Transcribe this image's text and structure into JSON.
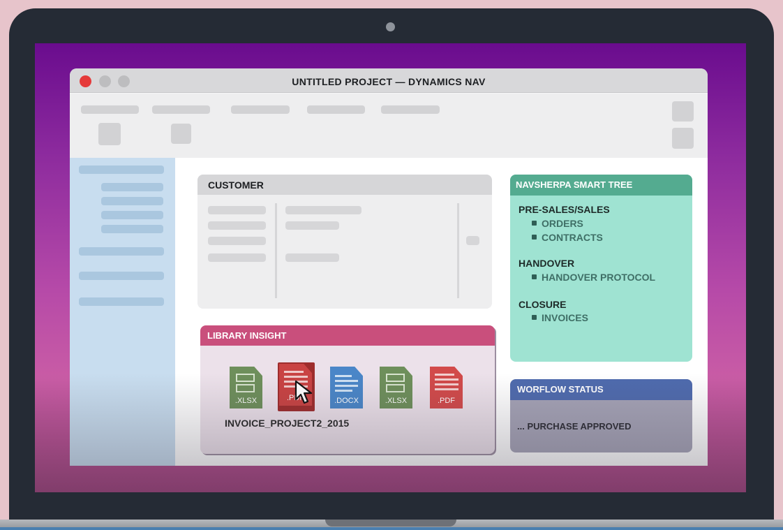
{
  "window": {
    "title": "UNTITLED PROJECT — DYNAMICS NAV",
    "controls": [
      "close",
      "minimize",
      "maximize"
    ],
    "close_color": "#e53a3a"
  },
  "customer": {
    "title": "CUSTOMER"
  },
  "library_insight": {
    "title": "LIBRARY INSIGHT",
    "files": [
      {
        "ext": ".XLSX",
        "color": "#6e8f5b"
      },
      {
        "ext": ".PDF",
        "color": "#c94343",
        "selected": true
      },
      {
        "ext": ".DOCX",
        "color": "#4a86c8"
      },
      {
        "ext": ".XLSX",
        "color": "#6e8f5b"
      },
      {
        "ext": ".PDF",
        "color": "#d24a4a"
      }
    ],
    "selected_file_name": "INVOICE_PROJECT2_2015"
  },
  "smart_tree": {
    "title": "NAVSHERPA SMART TREE",
    "sections": [
      {
        "label": "PRE-SALES/SALES",
        "items": [
          "ORDERS",
          "CONTRACTS"
        ]
      },
      {
        "label": "HANDOVER",
        "items": [
          "HANDOVER PROTOCOL"
        ]
      },
      {
        "label": "CLOSURE",
        "items": [
          "INVOICES"
        ]
      }
    ]
  },
  "workflow": {
    "title": "WORFLOW STATUS",
    "status": "... PURCHASE APPROVED"
  }
}
